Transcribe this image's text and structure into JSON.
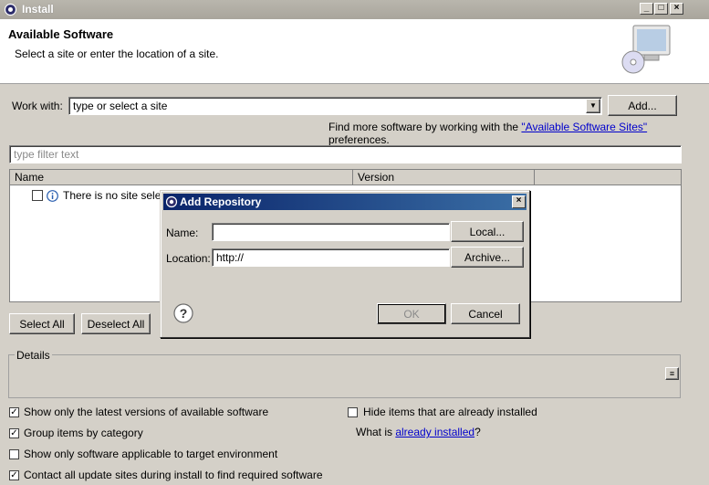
{
  "window": {
    "title": "Install"
  },
  "header": {
    "title": "Available Software",
    "description": "Select a site or enter the location of a site."
  },
  "work_with": {
    "label": "Work with:",
    "value": "type or select a site",
    "add_button": "Add..."
  },
  "find_more": {
    "prefix": "Find more software by working with the ",
    "link": "\"Available Software Sites\"",
    "suffix": " preferences."
  },
  "filter": {
    "placeholder": "type filter text"
  },
  "table": {
    "columns": [
      "Name",
      "Version"
    ],
    "rows": [
      {
        "name": "There is no site selected."
      }
    ]
  },
  "buttons": {
    "select_all": "Select All",
    "deselect_all": "Deselect All"
  },
  "details": {
    "label": "Details"
  },
  "options": {
    "latest_versions": {
      "label": "Show only the latest versions of available software",
      "checked": true
    },
    "hide_installed": {
      "label": "Hide items that are already installed",
      "checked": false
    },
    "group_by_category": {
      "label": "Group items by category",
      "checked": true
    },
    "what_is": {
      "prefix": "What is ",
      "link": "already installed",
      "suffix": "?"
    },
    "target_env": {
      "label": "Show only software applicable to target environment",
      "checked": false
    },
    "contact_sites": {
      "label": "Contact all update sites during install to find required software",
      "checked": true
    }
  },
  "dialog": {
    "title": "Add Repository",
    "name_label": "Name:",
    "name_value": "",
    "location_label": "Location:",
    "location_value": "http://",
    "local_button": "Local...",
    "archive_button": "Archive...",
    "ok_button": "OK",
    "cancel_button": "Cancel"
  }
}
